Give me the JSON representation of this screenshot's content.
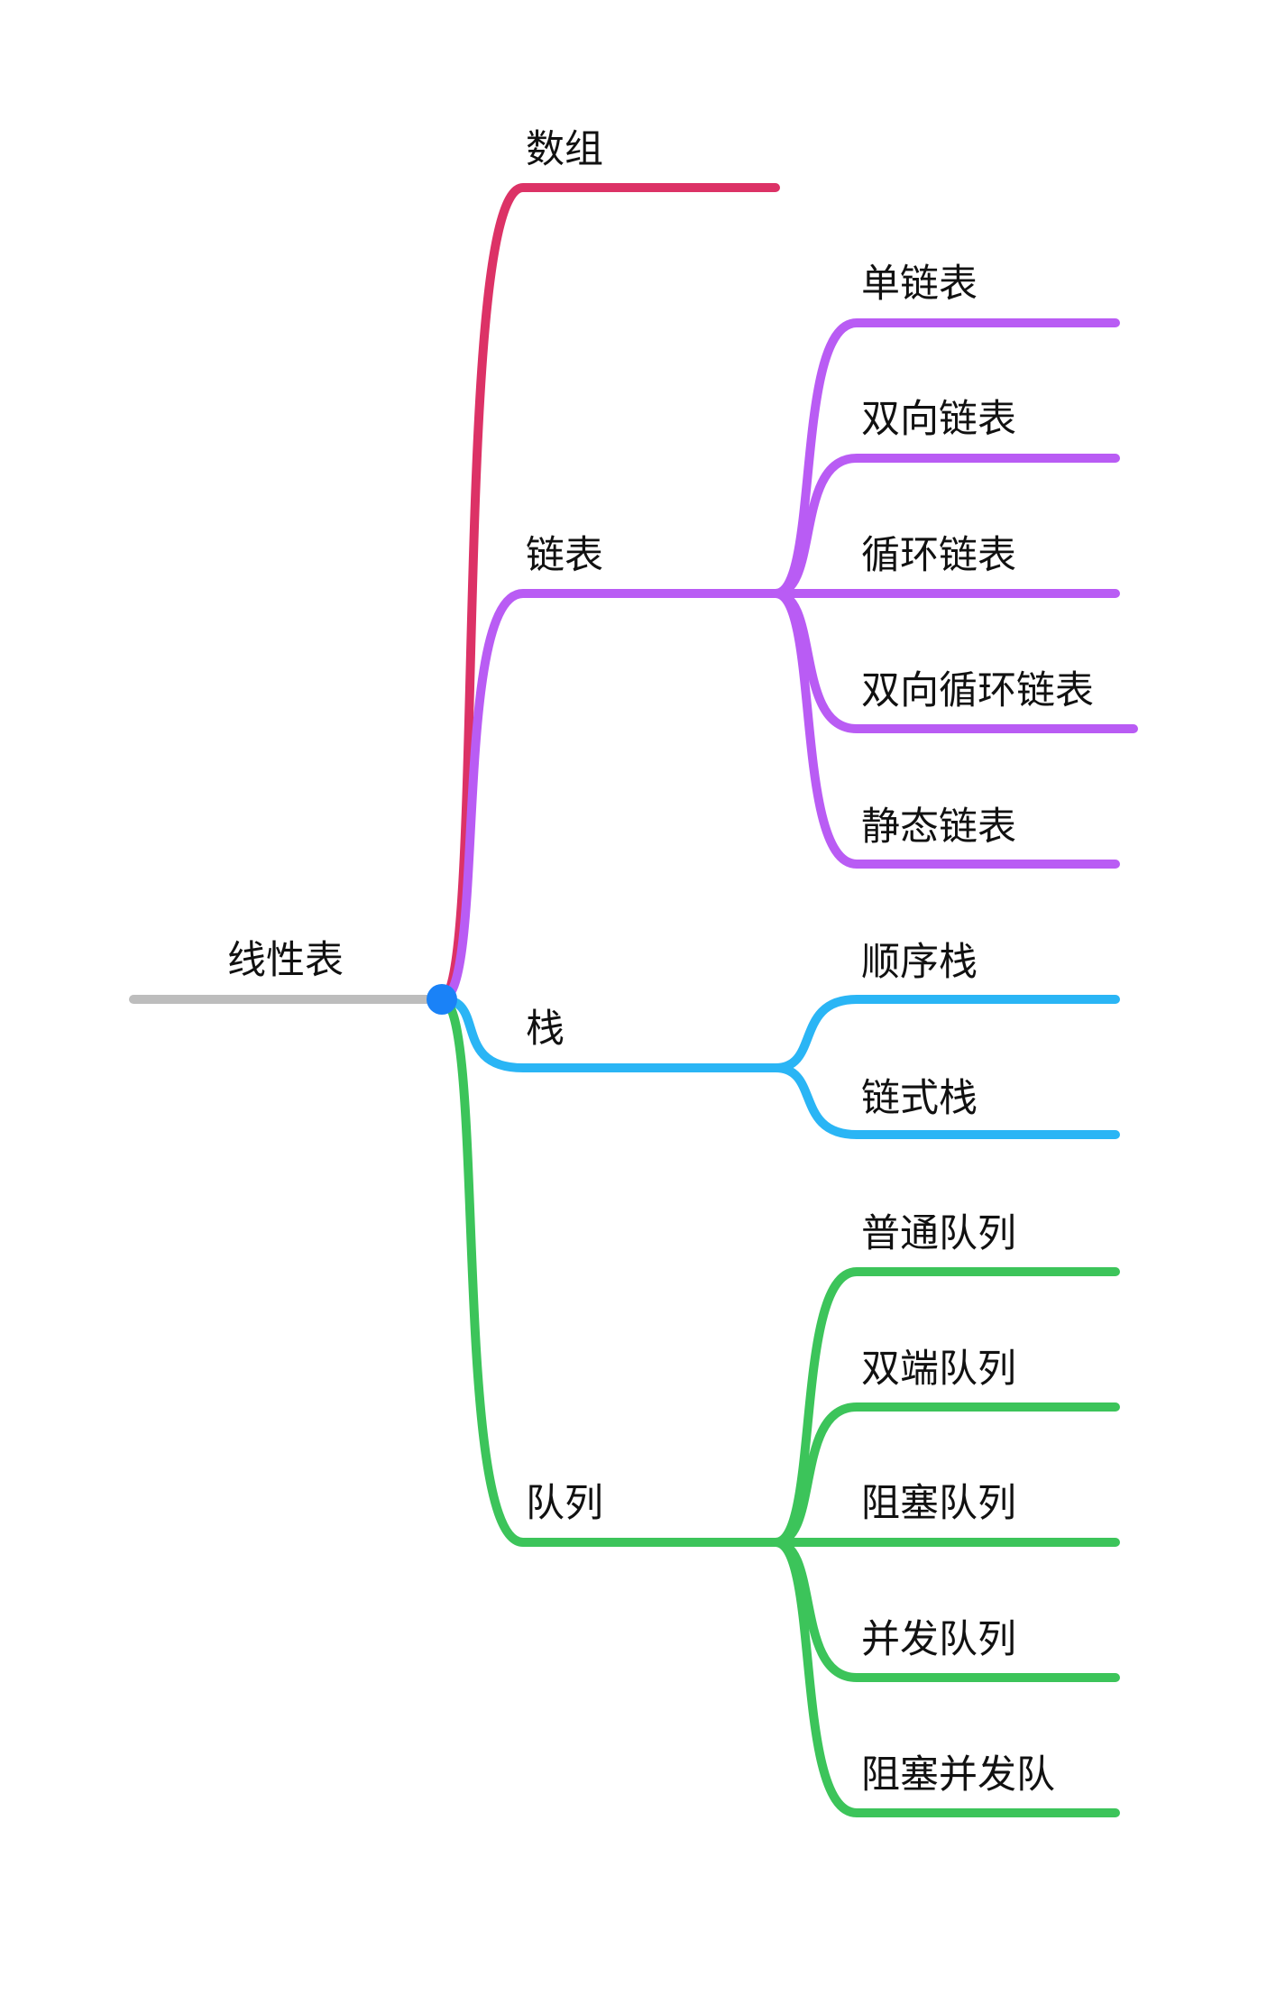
{
  "root": {
    "label": "线性表",
    "color": "#bdbdbd"
  },
  "hub_color": "#1a82f7",
  "branches": [
    {
      "id": "array",
      "label": "数组",
      "color": "#dc3266",
      "children": []
    },
    {
      "id": "linked",
      "label": "链表",
      "color": "#b95cf4",
      "children": [
        "单链表",
        "双向链表",
        "循环链表",
        "双向循环链表",
        "静态链表"
      ]
    },
    {
      "id": "stack",
      "label": "栈",
      "color": "#2ab5f5",
      "children": [
        "顺序栈",
        "链式栈"
      ]
    },
    {
      "id": "queue",
      "label": "队列",
      "color": "#3cc45a",
      "children": [
        "普通队列",
        "双端队列",
        "阻塞队列",
        "并发队列",
        "阻塞并发队"
      ]
    }
  ]
}
